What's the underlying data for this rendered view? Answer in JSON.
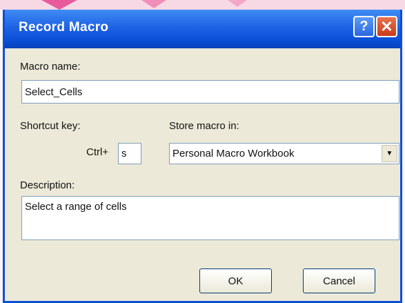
{
  "dialog": {
    "title": "Record Macro",
    "help_glyph": "?",
    "close_glyph": "✕"
  },
  "macro_name": {
    "label": "Macro name:",
    "value": "Select_Cells"
  },
  "shortcut": {
    "label": "Shortcut key:",
    "prefix": "Ctrl+",
    "value": "s"
  },
  "store": {
    "label": "Store macro in:",
    "selected": "Personal Macro Workbook",
    "arrow_glyph": "▼"
  },
  "description": {
    "label": "Description:",
    "value": "Select a range of cells"
  },
  "buttons": {
    "ok": "OK",
    "cancel": "Cancel"
  },
  "colors": {
    "titlebar": "#0a4fd6",
    "dialog_bg": "#ece9d8",
    "close_button": "#c83a1c",
    "watermark": "#e85a9b"
  }
}
